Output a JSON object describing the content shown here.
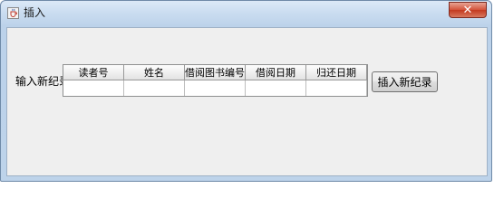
{
  "window": {
    "title": "插入",
    "close_symbol": "✕",
    "app_icon": "java-cup-icon"
  },
  "form": {
    "label": "输入新纪录",
    "table": {
      "columns": [
        "读者号",
        "姓名",
        "借阅图书编号",
        "借阅日期",
        "归还日期"
      ],
      "rows": [
        [
          "",
          "",
          "",
          "",
          ""
        ]
      ]
    },
    "insert_button_label": "插入新纪录"
  }
}
